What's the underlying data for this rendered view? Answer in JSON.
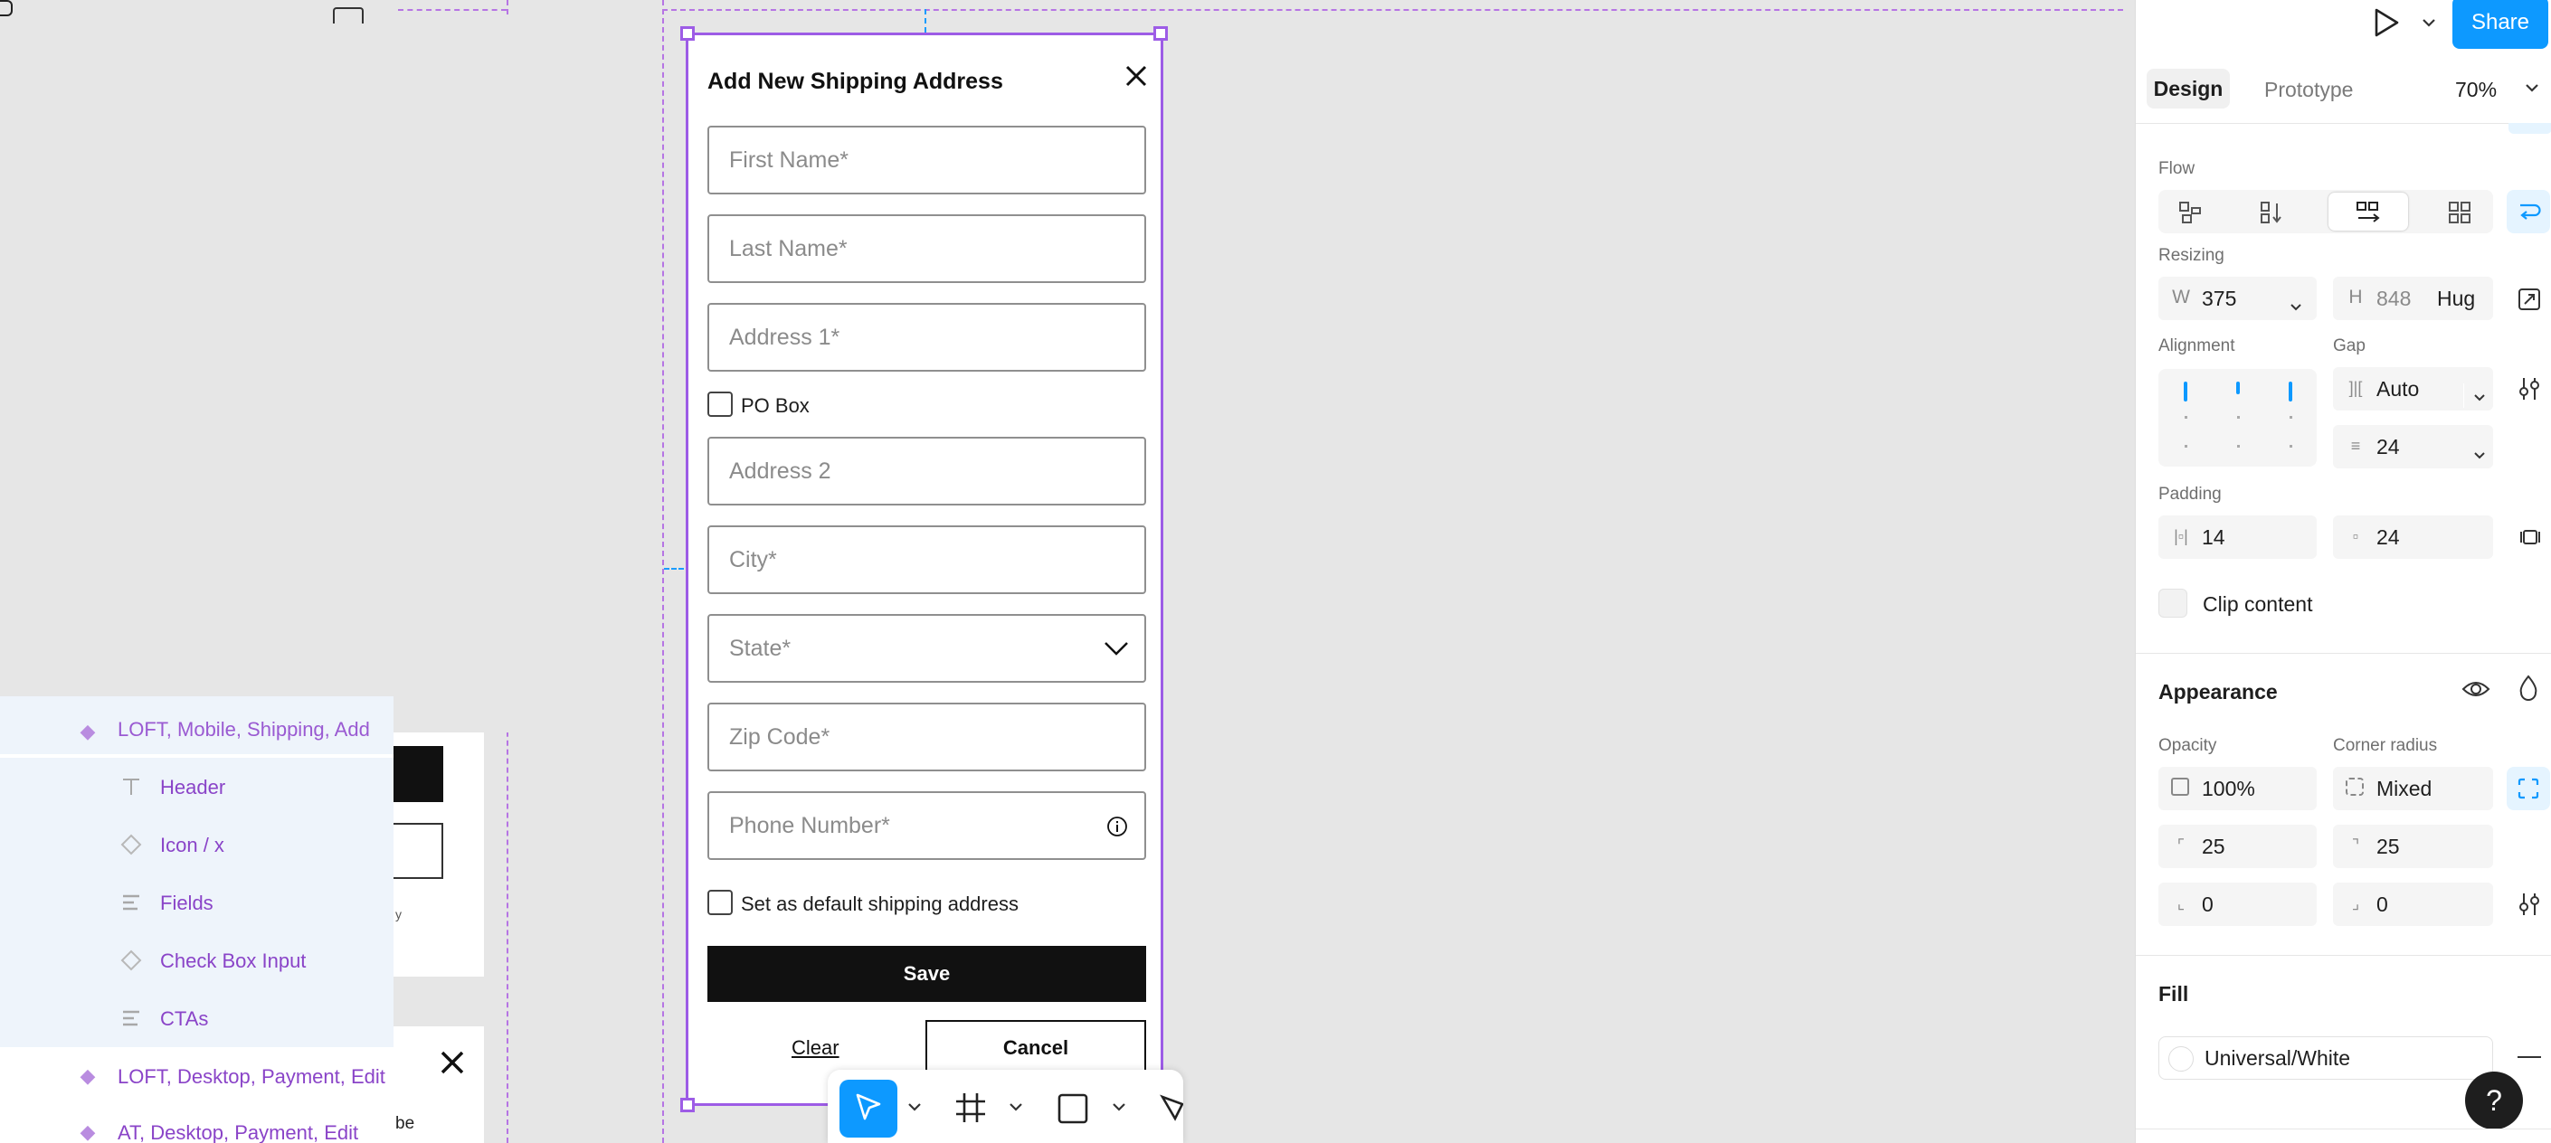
{
  "layers": {
    "items": [
      {
        "label": "LOFT, Mobile, Shipping, Add",
        "icon": "component-icon"
      },
      {
        "label": "Header",
        "icon": "text-icon"
      },
      {
        "label": "Icon / x",
        "icon": "instance-icon"
      },
      {
        "label": "Fields",
        "icon": "autolayout-icon"
      },
      {
        "label": "Check Box Input",
        "icon": "instance-icon"
      },
      {
        "label": "CTAs",
        "icon": "autolayout-icon"
      },
      {
        "label": "LOFT, Desktop, Payment, Edit",
        "icon": "component-icon"
      },
      {
        "label": "AT, Desktop, Payment, Edit",
        "icon": "component-icon"
      }
    ]
  },
  "canvas": {
    "bg_snippets": {
      "small_text": "y",
      "bottom_text": "be"
    }
  },
  "modal": {
    "title": "Add New Shipping Address",
    "first_name_placeholder": "First Name*",
    "last_name_placeholder": "Last Name*",
    "address1_placeholder": "Address 1*",
    "po_box_label": "PO Box",
    "address2_placeholder": "Address 2",
    "city_placeholder": "City*",
    "state_placeholder": "State*",
    "zip_placeholder": "Zip Code*",
    "phone_placeholder": "Phone Number*",
    "default_label": "Set as default shipping address",
    "save_label": "Save",
    "clear_label": "Clear",
    "cancel_label": "Cancel"
  },
  "header": {
    "share_label": "Share",
    "design_tab": "Design",
    "prototype_tab": "Prototype",
    "zoom": "70%"
  },
  "panel": {
    "flow_label": "Flow",
    "resizing_label": "Resizing",
    "width_prefix": "W",
    "width_value": "375",
    "height_prefix": "H",
    "height_value": "848",
    "height_mode": "Hug",
    "alignment_label": "Alignment",
    "gap_label": "Gap",
    "gap_h_value": "Auto",
    "gap_v_value": "24",
    "padding_label": "Padding",
    "padding_h_value": "14",
    "padding_v_value": "24",
    "clip_label": "Clip content",
    "appearance_label": "Appearance",
    "opacity_label": "Opacity",
    "opacity_value": "100%",
    "corner_label": "Corner radius",
    "corner_value": "Mixed",
    "radius_tl": "25",
    "radius_tr": "25",
    "radius_bl": "0",
    "radius_br": "0",
    "fill_label": "Fill",
    "fill_value": "Universal/White",
    "help_label": "?"
  },
  "colors": {
    "accent": "#0d99ff",
    "frame_purple": "#9d5ce6",
    "layer_purple": "#8a44c8"
  }
}
